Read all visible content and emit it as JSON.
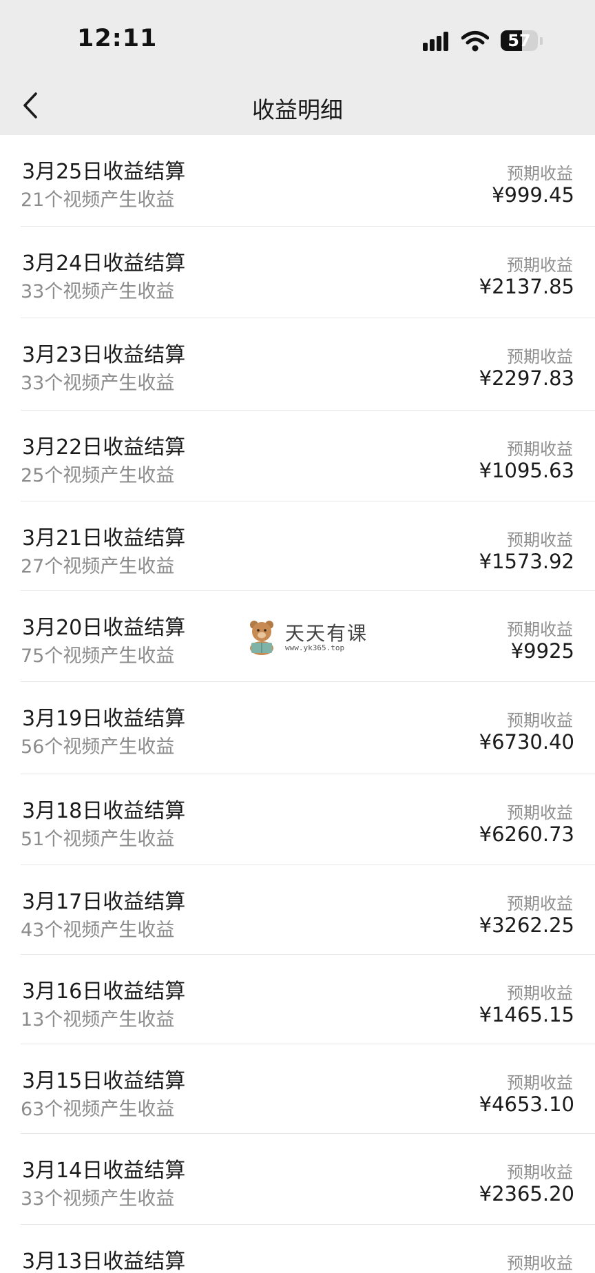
{
  "status_bar": {
    "time": "12:11",
    "battery_level": "57",
    "battery_fraction": 0.57,
    "icons": [
      "signal-icon",
      "wifi-icon",
      "battery-icon"
    ]
  },
  "nav": {
    "back_icon": "chevron-left-icon",
    "title": "收益明细"
  },
  "watermark": {
    "icon": "bear-reading-icon",
    "title": "天天有课",
    "url": "www.yk365.top"
  },
  "entries": [
    {
      "title": "3月25日收益结算",
      "subtitle": "21个视频产生收益",
      "label": "预期收益",
      "amount": "¥999.45"
    },
    {
      "title": "3月24日收益结算",
      "subtitle": "33个视频产生收益",
      "label": "预期收益",
      "amount": "¥2137.85"
    },
    {
      "title": "3月23日收益结算",
      "subtitle": "33个视频产生收益",
      "label": "预期收益",
      "amount": "¥2297.83"
    },
    {
      "title": "3月22日收益结算",
      "subtitle": "25个视频产生收益",
      "label": "预期收益",
      "amount": "¥1095.63"
    },
    {
      "title": "3月21日收益结算",
      "subtitle": "27个视频产生收益",
      "label": "预期收益",
      "amount": "¥1573.92"
    },
    {
      "title": "3月20日收益结算",
      "subtitle": "75个视频产生收益",
      "label": "预期收益",
      "amount": "¥9925"
    },
    {
      "title": "3月19日收益结算",
      "subtitle": "56个视频产生收益",
      "label": "预期收益",
      "amount": "¥6730.40"
    },
    {
      "title": "3月18日收益结算",
      "subtitle": "51个视频产生收益",
      "label": "预期收益",
      "amount": "¥6260.73"
    },
    {
      "title": "3月17日收益结算",
      "subtitle": "43个视频产生收益",
      "label": "预期收益",
      "amount": "¥3262.25"
    },
    {
      "title": "3月16日收益结算",
      "subtitle": "13个视频产生收益",
      "label": "预期收益",
      "amount": "¥1465.15"
    },
    {
      "title": "3月15日收益结算",
      "subtitle": "63个视频产生收益",
      "label": "预期收益",
      "amount": "¥4653.10"
    },
    {
      "title": "3月14日收益结算",
      "subtitle": "33个视频产生收益",
      "label": "预期收益",
      "amount": "¥2365.20"
    },
    {
      "title": "3月13日收益结算",
      "subtitle": "",
      "label": "预期收益",
      "amount": ""
    }
  ]
}
